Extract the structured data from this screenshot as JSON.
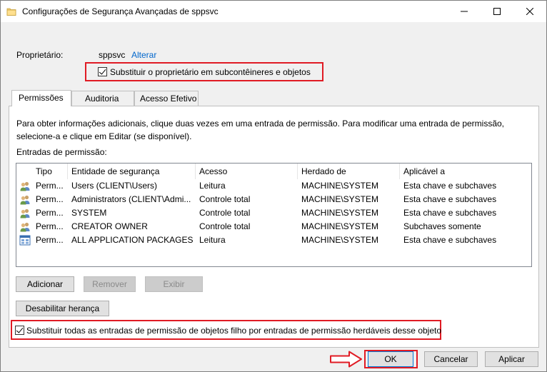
{
  "window": {
    "title": "Configurações de Segurança Avançadas de sppsvc"
  },
  "owner": {
    "label": "Proprietário:",
    "value": "sppsvc",
    "change_link": "Alterar"
  },
  "replace_owner": {
    "label": "Substituir o proprietário em subcontêineres e objetos",
    "checked": true
  },
  "tabs": [
    {
      "label": "Permissões",
      "active": true
    },
    {
      "label": "Auditoria",
      "active": false
    },
    {
      "label": "Acesso Efetivo",
      "active": false
    }
  ],
  "permissions": {
    "info_text": "Para obter informações adicionais, clique duas vezes em uma entrada de permissão. Para modificar uma entrada de permissão, selecione-a e clique em Editar (se disponível).",
    "entries_label": "Entradas de permissão:",
    "columns": [
      "Tipo",
      "Entidade de segurança",
      "Acesso",
      "Herdado de",
      "Aplicável a"
    ],
    "rows": [
      {
        "icon": "users-group-icon",
        "type": "Perm...",
        "principal": "Users (CLIENT\\Users)",
        "access": "Leitura",
        "inherited": "MACHINE\\SYSTEM",
        "applies": "Esta chave e subchaves"
      },
      {
        "icon": "users-group-icon",
        "type": "Perm...",
        "principal": "Administrators (CLIENT\\Admi...",
        "access": "Controle total",
        "inherited": "MACHINE\\SYSTEM",
        "applies": "Esta chave e subchaves"
      },
      {
        "icon": "users-group-icon",
        "type": "Perm...",
        "principal": "SYSTEM",
        "access": "Controle total",
        "inherited": "MACHINE\\SYSTEM",
        "applies": "Esta chave e subchaves"
      },
      {
        "icon": "users-group-icon",
        "type": "Perm...",
        "principal": "CREATOR OWNER",
        "access": "Controle total",
        "inherited": "MACHINE\\SYSTEM",
        "applies": "Subchaves somente"
      },
      {
        "icon": "app-packages-icon",
        "type": "Perm...",
        "principal": "ALL APPLICATION PACKAGES",
        "access": "Leitura",
        "inherited": "MACHINE\\SYSTEM",
        "applies": "Esta chave e subchaves"
      }
    ],
    "buttons": {
      "add": "Adicionar",
      "remove": "Remover",
      "view": "Exibir",
      "disable_inheritance": "Desabilitar herança"
    },
    "replace_child": {
      "label": "Substituir todas as entradas de permissão de objetos filho por entradas de permissão herdáveis desse objeto",
      "checked": true
    }
  },
  "footer": {
    "ok": "OK",
    "cancel": "Cancelar",
    "apply": "Aplicar"
  },
  "colors": {
    "highlight": "#e01b24",
    "link": "#0066cc",
    "focus": "#0078d7"
  }
}
